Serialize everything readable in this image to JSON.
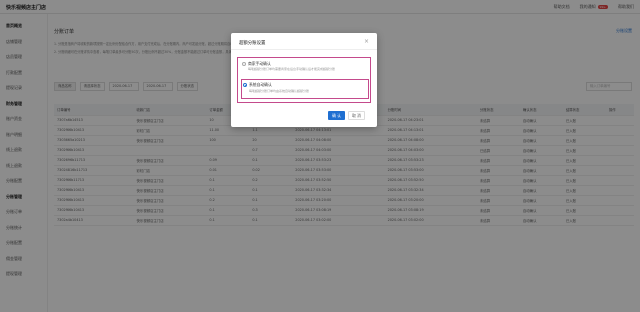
{
  "app": {
    "title": "快乐视频店主门店",
    "top_links": [
      "帮助文档",
      "我的通知",
      "帮助我们"
    ],
    "notification_count": "99+"
  },
  "sidebar": {
    "items": [
      {
        "label": "首页概览",
        "type": "group"
      },
      {
        "label": "店铺管理",
        "type": "item"
      },
      {
        "label": "店员管理",
        "type": "item"
      },
      {
        "label": "打款配置",
        "type": "item"
      },
      {
        "label": "提现记录",
        "type": "item"
      },
      {
        "label": "财务管理",
        "type": "group"
      },
      {
        "label": "账户资金",
        "type": "item"
      },
      {
        "label": "账户明细",
        "type": "item"
      },
      {
        "label": "线上退款",
        "type": "item"
      },
      {
        "label": "线上退款",
        "type": "item"
      },
      {
        "label": "分账配置",
        "type": "item"
      },
      {
        "label": "分账管理",
        "type": "group"
      },
      {
        "label": "分账订单",
        "type": "item"
      },
      {
        "label": "分账统计",
        "type": "item"
      },
      {
        "label": "分账配置",
        "type": "item"
      },
      {
        "label": "佣金管理",
        "type": "item"
      },
      {
        "label": "提现管理",
        "type": "item"
      }
    ]
  },
  "page": {
    "title": "分账订单",
    "settings_link": "分账设置",
    "notices": [
      "1. 分账是指商户将收取的款项按照一定比例分配给合作方，用户支付完成后，在分账期内，商户可发起分账，超过分账期将自动解冻资金。",
      "2. 分账明细可在分账详情中查看，每笔订单最多可分账50次，分账比例不超过30%，分账金额不能超过订单可分账金额，具体请查看分账规则说明。"
    ]
  },
  "filters": {
    "items": [
      "商品名称",
      "请选择状态",
      "2020-06-17",
      "2020-06-17",
      "分账状态"
    ],
    "search_placeholder": "输入订单编号"
  },
  "table": {
    "headers": [
      "订单编号",
      "收款门店",
      "订单金额",
      "分账金额",
      "下单时间",
      "分账时间",
      "分账状态",
      "确认状态",
      "结算状态",
      "操作"
    ],
    "rows": [
      [
        "7307a6b14513",
        "快乐视频店主门店",
        "10",
        "",
        "2020-06-17 04:23:01",
        "2020-06-17 04:23:01",
        "未结算",
        "自动确认",
        "已入账",
        ""
      ],
      [
        "7302f66b10413",
        "彩虹门店",
        "11.00",
        "1.1",
        "2020-06-17 04:13:01",
        "2020-06-17 04:13:01",
        "未结算",
        "自动确认",
        "已入账",
        ""
      ],
      [
        "7303665a10213",
        "快乐视频店主门店",
        "100",
        "20",
        "2020-06-17 04:08:00",
        "2020-06-17 04:08:00",
        "未结算",
        "自动确认",
        "已入账",
        ""
      ],
      [
        "7302f66b10413",
        "",
        "",
        "0.7",
        "2020-06-17 04:03:00",
        "2020-06-17 04:03:00",
        "已结算",
        "自动确认",
        "已入账",
        ""
      ],
      [
        "7302696b11713",
        "快乐视频店主门店",
        "0.09",
        "0.1",
        "2020-06-17 03:53:23",
        "2020-06-17 03:53:23",
        "未结算",
        "自动确认",
        "已入账",
        ""
      ],
      [
        "73024816b11713",
        "彩虹门店",
        "0.01",
        "0.02",
        "2020-06-17 03:53:00",
        "2020-06-17 03:53:00",
        "未结算",
        "自动确认",
        "已入账",
        ""
      ],
      [
        "7302f66b11713",
        "快乐视频店主门店",
        "0.1",
        "0.2",
        "2020-06-17 03:52:50",
        "2020-06-17 03:52:50",
        "未结算",
        "自动确认",
        "已入账",
        ""
      ],
      [
        "7302f66b10413",
        "快乐视频店主门店",
        "0.1",
        "0.1",
        "2020-06-17 03:32:34",
        "2020-06-17 03:32:34",
        "未结算",
        "自动确认",
        "已入账",
        ""
      ],
      [
        "7302f66b10413",
        "快乐视频店主门店",
        "0.2",
        "0.1",
        "2020-06-17 03:20:00",
        "2020-06-17 03:20:00",
        "未结算",
        "自动确认",
        "已入账",
        ""
      ],
      [
        "7302f66b10413",
        "快乐视频店主门店",
        "0.1",
        "0.3",
        "2020-06-17 03:08:19",
        "2020-06-17 03:08:19",
        "未结算",
        "自动确认",
        "已入账",
        ""
      ],
      [
        "7302a4b10413",
        "快乐视频店主门店",
        "0.1",
        "0.1",
        "2020-06-17 03:02:00",
        "2020-06-17 03:02:00",
        "未结算",
        "自动确认",
        "已入账",
        ""
      ]
    ]
  },
  "modal": {
    "title": "超额分账设置",
    "options": [
      {
        "label": "商家手动确认",
        "desc": "每笔超额分账订单均需要商家在后台手动确认后才能完成超额分账",
        "selected": false
      },
      {
        "label": "系统自动确认",
        "desc": "每笔超额分账订单均由系统自动确认超额分账",
        "selected": true
      }
    ],
    "ok_label": "确 认",
    "cancel_label": "取 消"
  },
  "colors": {
    "accent": "#1f6fd1",
    "highlight_border": "#c44a8c",
    "overlay": "rgba(0,0,0,0.45)"
  }
}
